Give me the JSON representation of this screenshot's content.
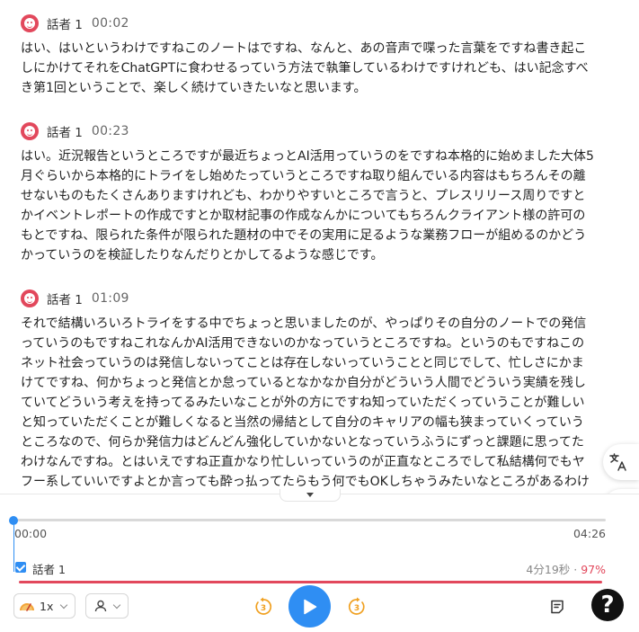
{
  "segments": [
    {
      "speaker": "話者 1",
      "time": "00:02",
      "text": "はい、はいというわけですねこのノートはですね、なんと、あの音声で喋った言葉をですね書き起こしにかけてそれをChatGPTに食わせるっていう方法で執筆しているわけですけれども、はい記念すべき第1回ということで、楽しく続けていきたいなと思います。"
    },
    {
      "speaker": "話者 1",
      "time": "00:23",
      "text": "はい。近況報告というところですが最近ちょっとAI活用っていうのをですね本格的に始めました大体5月ぐらいから本格的にトライをし始めたっていうところですね取り組んでいる内容はもちろんその離せないものもたくさんありますけれども、わかりやすいところで言うと、プレスリリース周りですとかイベントレポートの作成ですとか取材記事の作成なんかについてもちろんクライアント様の許可のもとですね、限られた条件が限られた題材の中でその実用に足るような業務フローが組めるのかどうかっていうのを検証したりなんだりとかしてるような感じです。"
    },
    {
      "speaker": "話者 1",
      "time": "01:09",
      "text": "それで結構いろいろトライをする中でちょっと思いましたのが、やっぱりその自分のノートでの発信っていうのもですねこれなんかAI活用できないのかなっていうところですね。というのもですねこのネット社会っていうのは発信しないってことは存在しないっていうことと同じでして、忙しさにかまけてですね、何かちょっと発信とか怠っているとなかなか自分がどういう人間でどういう実績を残していてどういう考えを持ってるみたいなことが外の方にですね知っていただくっていうことが難しいと知っていただくことが難しくなると当然の帰結として自分のキャリアの幅も狭まっていくっていうところなので、何らか発信力はどんどん強化していかないとなっていうふうにずっと課題に思ってたわけなんですね。とはいえですね正直かなり忙しいっていうのが正直なところでして私結構何でもヤフー系していいですよとか言っても酔っ払ってたらもう何でもOKしちゃうみたいなところがあるわけ"
    }
  ],
  "player": {
    "current_time": "00:00",
    "total_time": "04:26",
    "progress": 0.0,
    "speaker_filter": {
      "name": "話者 1",
      "checked": true,
      "duration": "4分19秒",
      "separator": " · ",
      "share": "97%",
      "share_fraction": 0.97
    },
    "speed_label": "1x",
    "rewind_seconds": "3",
    "forward_seconds": "3",
    "help_label": "?"
  },
  "icons": {
    "avatar": "speaker-avatar-icon",
    "translate": "translate-icon",
    "ai": "ai-assistant-icon",
    "speed": "speed-meter-icon",
    "speaker_filter": "person-icon",
    "rewind": "rewind-3s-icon",
    "play": "play-icon",
    "forward": "forward-3s-icon",
    "notes": "notes-icon",
    "help": "help-icon"
  },
  "colors": {
    "accent": "#2f8ef3",
    "speaker": "#e2485c",
    "text": "#222222",
    "muted": "#666666"
  }
}
